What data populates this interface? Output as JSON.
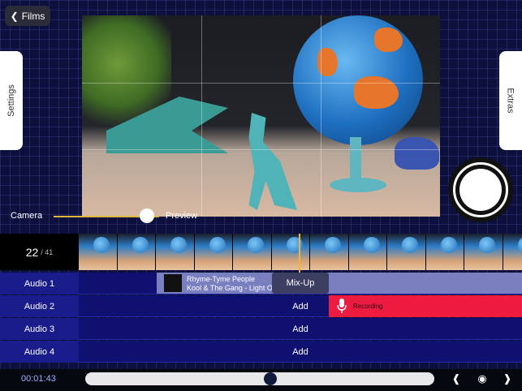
{
  "nav": {
    "back_label": "Films"
  },
  "side_tabs": {
    "left": "Settings",
    "right": "Extras"
  },
  "preview": {
    "mode_left": "Camera",
    "mode_right": "Preview",
    "slider_position": 0.9
  },
  "frames": {
    "current": "22",
    "total": "/ 41"
  },
  "tracks": [
    {
      "label": "Audio 1",
      "action": "Mix-Up"
    },
    {
      "label": "Audio 2",
      "action": "Add"
    },
    {
      "label": "Audio 3",
      "action": "Add"
    },
    {
      "label": "Audio 4",
      "action": "Add"
    }
  ],
  "audio_clip": {
    "title": "Rhyme-Tyme People",
    "artist": "Kool & The Gang - Light Of Worlds"
  },
  "recording_clip": {
    "label": "Recording"
  },
  "playback": {
    "time": "00:01:43",
    "progress": 0.53
  },
  "icons": [
    "chevron-left-icon",
    "record-button",
    "skip-back-icon",
    "onion-skin-icon",
    "skip-forward-icon",
    "microphone-icon"
  ],
  "colors": {
    "accent": "#f0b43b",
    "recording": "#ec1b3f",
    "track_label_bg": "#1b1c8c"
  }
}
